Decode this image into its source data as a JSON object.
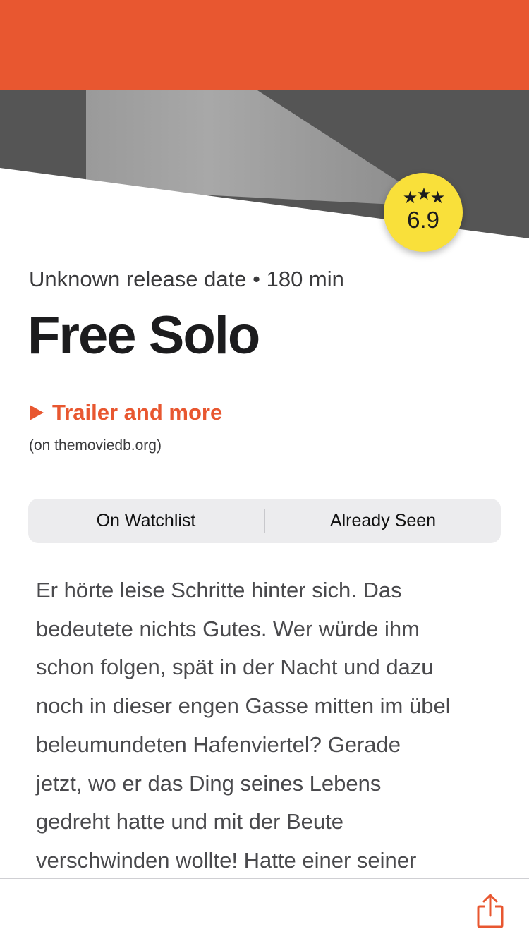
{
  "colors": {
    "accent": "#E85730",
    "rating_badge": "#F9E03A",
    "text_primary": "#1C1C1E",
    "text_secondary": "#3A3A3C"
  },
  "hero": {
    "image": "movie-backdrop-image"
  },
  "rating": {
    "stars_icon": "three-stars-icon",
    "stars": [
      "★",
      "★",
      "★"
    ],
    "value": "6.9"
  },
  "movie": {
    "release_info": "Unknown release date",
    "separator": "•",
    "runtime": "180 min",
    "title": "Free Solo"
  },
  "trailer": {
    "icon": "play-icon",
    "label": "Trailer and more",
    "source": "(on themoviedb.org)"
  },
  "segmented_control": {
    "watchlist_label": "On Watchlist",
    "seen_label": "Already Seen"
  },
  "overview": {
    "lines": [
      "Er hörte leise Schritte hinter sich. Das",
      "bedeutete nichts Gutes. Wer würde ihm",
      "schon folgen, spät in der Nacht und dazu",
      "noch in dieser engen Gasse mitten im übel",
      "beleumundeten Hafenviertel? Gerade",
      "jetzt, wo er das Ding seines Lebens",
      "gedreht hatte und mit der Beute",
      "verschwinden wollte! Hatte einer seiner"
    ]
  },
  "toolbar": {
    "share_icon": "share-icon"
  }
}
